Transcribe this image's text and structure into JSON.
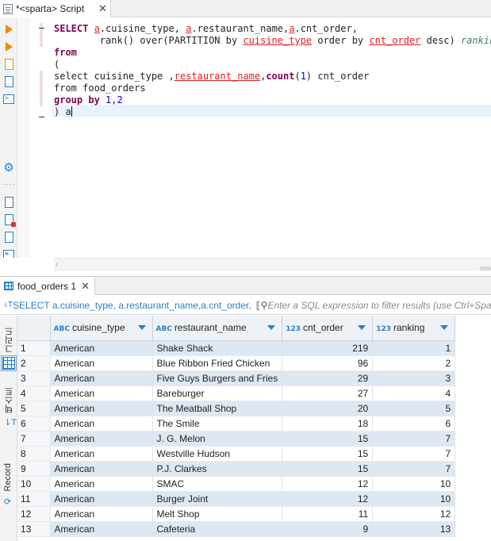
{
  "editor": {
    "tab_title": "*<sparta> Script",
    "close_glyph": "✕",
    "lines": [
      [
        {
          "t": "SELECT ",
          "c": "kw"
        },
        {
          "t": "a",
          "c": "ul"
        },
        {
          "t": ".cuisine_type, ",
          "c": ""
        },
        {
          "t": "a",
          "c": "ul"
        },
        {
          "t": ".restaurant_name,",
          "c": ""
        },
        {
          "t": "a",
          "c": "ul"
        },
        {
          "t": ".cnt_order,",
          "c": ""
        }
      ],
      [
        {
          "t": "        rank() over(PARTITION by ",
          "c": ""
        },
        {
          "t": "cuisine_type",
          "c": "ul"
        },
        {
          "t": " order by ",
          "c": ""
        },
        {
          "t": "cnt_order",
          "c": "ul"
        },
        {
          "t": " desc) ",
          "c": ""
        },
        {
          "t": "ranking",
          "c": "cm"
        }
      ],
      [
        {
          "t": "from",
          "c": "kw"
        }
      ],
      [
        {
          "t": "(",
          "c": ""
        }
      ],
      [
        {
          "t": "select cuisine_type ,",
          "c": ""
        },
        {
          "t": "restaurant_name",
          "c": "ul"
        },
        {
          "t": ",",
          "c": ""
        },
        {
          "t": "count",
          "c": "kw"
        },
        {
          "t": "(",
          "c": ""
        },
        {
          "t": "1",
          "c": "num"
        },
        {
          "t": ") cnt_order",
          "c": ""
        }
      ],
      [
        {
          "t": "from food_orders",
          "c": ""
        }
      ],
      [
        {
          "t": "group by ",
          "c": "kw"
        },
        {
          "t": "1",
          "c": "num"
        },
        {
          "t": ",",
          "c": ""
        },
        {
          "t": "2",
          "c": "num"
        }
      ],
      [
        {
          "t": ") a",
          "c": ""
        }
      ]
    ]
  },
  "results": {
    "tab_title": "food_orders 1",
    "close_glyph": "✕",
    "sql_preview": "SELECT a.cuisine_type, a.restaurant_name,a.cnt_order,",
    "filter_placeholder": "Enter a SQL expression to filter results (use Ctrl+Space)",
    "side_labels": {
      "grid": "그리드",
      "text": "텍스트",
      "record": "Record"
    },
    "columns": [
      {
        "type": "ABC",
        "name": "cuisine_type"
      },
      {
        "type": "ABC",
        "name": "restaurant_name"
      },
      {
        "type": "123",
        "name": "cnt_order"
      },
      {
        "type": "123",
        "name": "ranking"
      }
    ],
    "rows": [
      [
        "1",
        "American",
        "Shake Shack",
        "219",
        "1"
      ],
      [
        "2",
        "American",
        "Blue Ribbon Fried Chicken",
        "96",
        "2"
      ],
      [
        "3",
        "American",
        "Five Guys Burgers and Fries",
        "29",
        "3"
      ],
      [
        "4",
        "American",
        "Bareburger",
        "27",
        "4"
      ],
      [
        "5",
        "American",
        "The Meatball Shop",
        "20",
        "5"
      ],
      [
        "6",
        "American",
        "The Smile",
        "18",
        "6"
      ],
      [
        "7",
        "American",
        "J. G. Melon",
        "15",
        "7"
      ],
      [
        "8",
        "American",
        "Westville Hudson",
        "15",
        "7"
      ],
      [
        "9",
        "American",
        "P.J. Clarkes",
        "15",
        "7"
      ],
      [
        "10",
        "American",
        "SMAC",
        "12",
        "10"
      ],
      [
        "11",
        "American",
        "Burger Joint",
        "12",
        "10"
      ],
      [
        "12",
        "American",
        "Melt Shop",
        "11",
        "12"
      ],
      [
        "13",
        "American",
        "Cafeteria",
        "9",
        "13"
      ]
    ]
  }
}
